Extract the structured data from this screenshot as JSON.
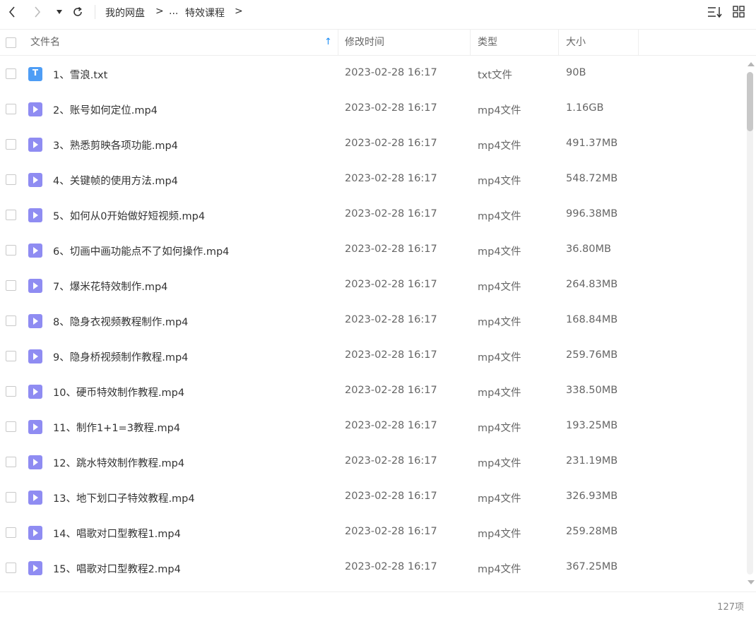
{
  "toolbar": {
    "back_icon": "chevron-left-icon",
    "forward_icon": "chevron-right-icon",
    "history_icon": "caret-down-icon",
    "refresh_icon": "refresh-icon",
    "breadcrumb": {
      "root": "我的网盘",
      "sep1": ">",
      "ellipsis": "...",
      "current": "特效课程",
      "sep2": ">"
    },
    "sort_icon": "sort-icon",
    "view_icon": "grid-view-icon"
  },
  "header": {
    "name": "文件名",
    "modified": "修改时间",
    "type": "类型",
    "size": "大小",
    "sort_indicator": "↑"
  },
  "files": [
    {
      "name": "1、雪浪.txt",
      "date": "2023-02-28 16:17",
      "type": "txt文件",
      "size": "90B",
      "icon": "txt-file-icon"
    },
    {
      "name": "2、账号如何定位.mp4",
      "date": "2023-02-28 16:17",
      "type": "mp4文件",
      "size": "1.16GB",
      "icon": "video-file-icon"
    },
    {
      "name": "3、熟悉剪映各项功能.mp4",
      "date": "2023-02-28 16:17",
      "type": "mp4文件",
      "size": "491.37MB",
      "icon": "video-file-icon"
    },
    {
      "name": "4、关键帧的使用方法.mp4",
      "date": "2023-02-28 16:17",
      "type": "mp4文件",
      "size": "548.72MB",
      "icon": "video-file-icon"
    },
    {
      "name": "5、如何从0开始做好短视频.mp4",
      "date": "2023-02-28 16:17",
      "type": "mp4文件",
      "size": "996.38MB",
      "icon": "video-file-icon"
    },
    {
      "name": "6、切画中画功能点不了如何操作.mp4",
      "date": "2023-02-28 16:17",
      "type": "mp4文件",
      "size": "36.80MB",
      "icon": "video-file-icon"
    },
    {
      "name": "7、爆米花特效制作.mp4",
      "date": "2023-02-28 16:17",
      "type": "mp4文件",
      "size": "264.83MB",
      "icon": "video-file-icon"
    },
    {
      "name": "8、隐身衣视频教程制作.mp4",
      "date": "2023-02-28 16:17",
      "type": "mp4文件",
      "size": "168.84MB",
      "icon": "video-file-icon"
    },
    {
      "name": "9、隐身桥视频制作教程.mp4",
      "date": "2023-02-28 16:17",
      "type": "mp4文件",
      "size": "259.76MB",
      "icon": "video-file-icon"
    },
    {
      "name": "10、硬币特效制作教程.mp4",
      "date": "2023-02-28 16:17",
      "type": "mp4文件",
      "size": "338.50MB",
      "icon": "video-file-icon"
    },
    {
      "name": "11、制作1+1=3教程.mp4",
      "date": "2023-02-28 16:17",
      "type": "mp4文件",
      "size": "193.25MB",
      "icon": "video-file-icon"
    },
    {
      "name": "12、跳水特效制作教程.mp4",
      "date": "2023-02-28 16:17",
      "type": "mp4文件",
      "size": "231.19MB",
      "icon": "video-file-icon"
    },
    {
      "name": "13、地下划口子特效教程.mp4",
      "date": "2023-02-28 16:17",
      "type": "mp4文件",
      "size": "326.93MB",
      "icon": "video-file-icon"
    },
    {
      "name": "14、唱歌对口型教程1.mp4",
      "date": "2023-02-28 16:17",
      "type": "mp4文件",
      "size": "259.28MB",
      "icon": "video-file-icon"
    },
    {
      "name": "15、唱歌对口型教程2.mp4",
      "date": "2023-02-28 16:17",
      "type": "mp4文件",
      "size": "367.25MB",
      "icon": "video-file-icon"
    }
  ],
  "footer": {
    "count": "127项"
  },
  "colors": {
    "txt_icon": "#4e9df5",
    "video_icon": "#8f8cf2",
    "sort_arrow": "#1a8cf5"
  }
}
